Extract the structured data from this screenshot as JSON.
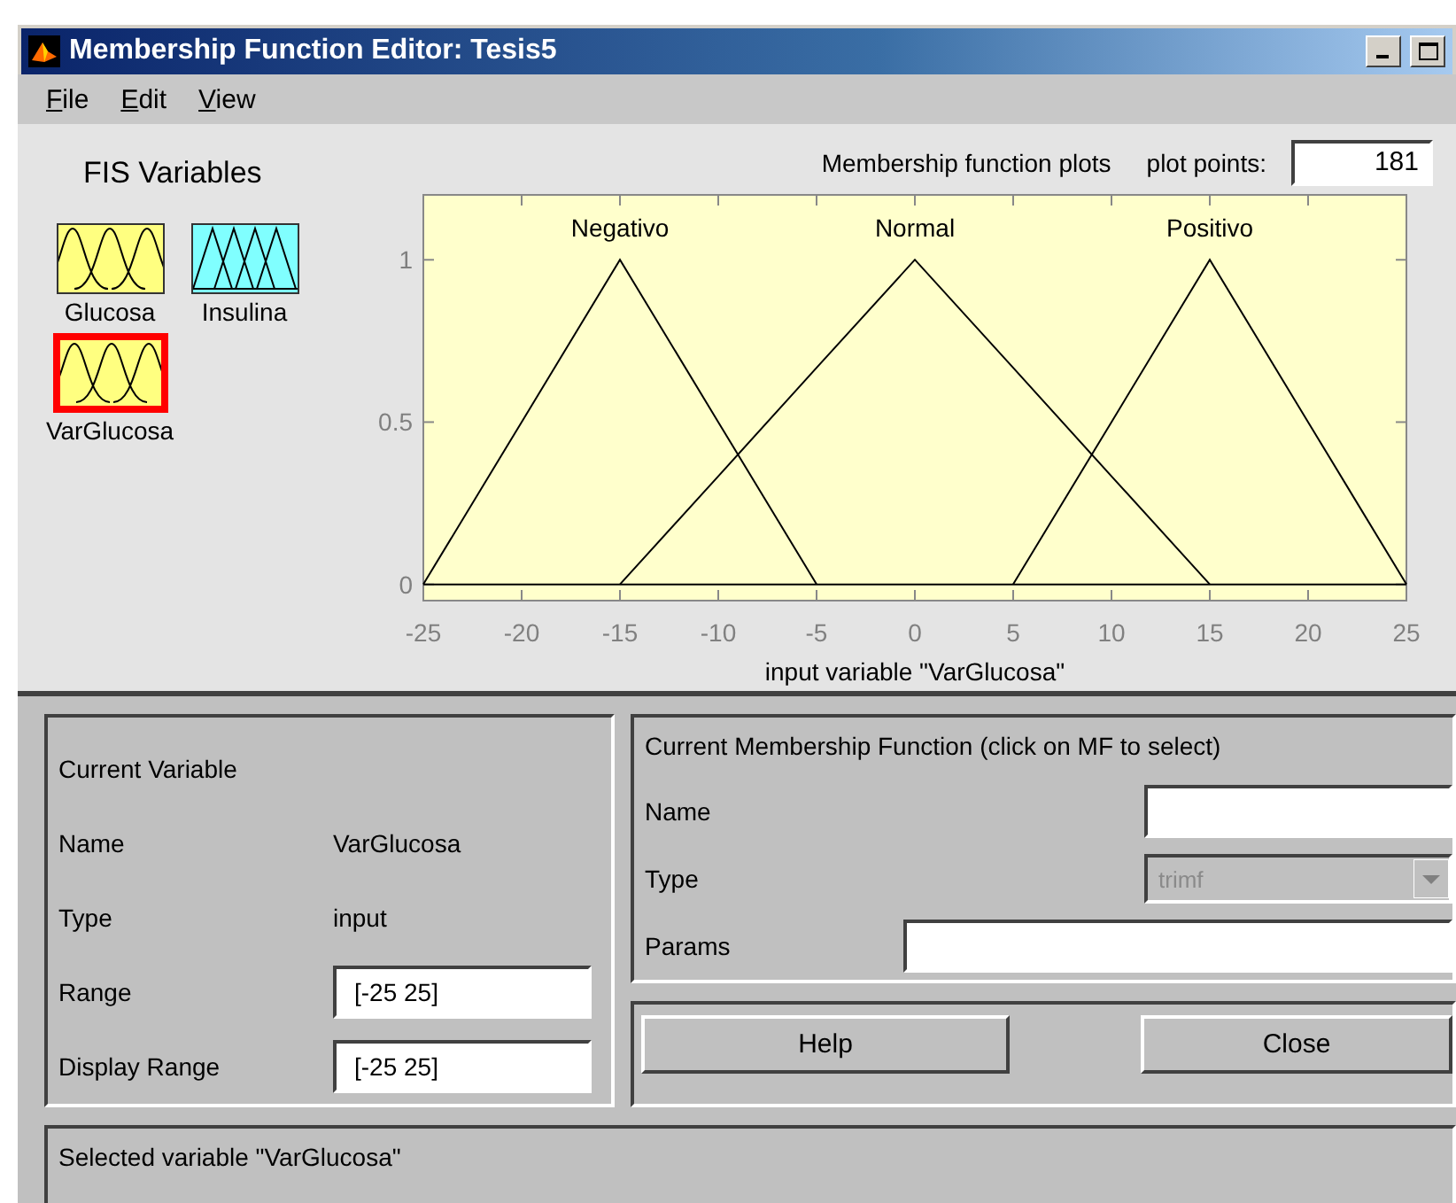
{
  "window": {
    "title": "Membership Function Editor: Tesis5"
  },
  "menu": [
    {
      "label": "File"
    },
    {
      "label": "Edit"
    },
    {
      "label": "View"
    }
  ],
  "fis_variables": {
    "title": "FIS Variables",
    "items": [
      {
        "name": "Glucosa",
        "kind": "input",
        "selected": false
      },
      {
        "name": "Insulina",
        "kind": "output",
        "selected": false
      },
      {
        "name": "VarGlucosa",
        "kind": "input",
        "selected": true
      }
    ]
  },
  "plot": {
    "plot_points": {
      "label": "plot points:",
      "value": "181"
    },
    "chart_data": {
      "type": "line",
      "title": "Membership function plots",
      "xlabel": "input variable \"VarGlucosa\"",
      "x": [
        -25,
        -20,
        -15,
        -10,
        -5,
        0,
        5,
        10,
        15,
        20,
        25
      ],
      "series": [
        {
          "name": "Negativo",
          "color": "#000000",
          "values": [
            0,
            0.5,
            1,
            0.5,
            0,
            null,
            null,
            null,
            null,
            null,
            null
          ]
        },
        {
          "name": "Normal",
          "color": "#000000",
          "values": [
            null,
            null,
            0,
            0.333,
            0.667,
            1,
            0.667,
            0.333,
            0,
            null,
            null
          ]
        },
        {
          "name": "Positivo",
          "color": "#000000",
          "values": [
            null,
            null,
            null,
            null,
            null,
            null,
            0,
            0.5,
            1,
            0.5,
            0
          ]
        }
      ],
      "xlim": [
        -25,
        25
      ],
      "ylim": [
        -0.05,
        1.2
      ],
      "xticks": [
        -25,
        -20,
        -15,
        -10,
        -5,
        0,
        5,
        10,
        15,
        20,
        25
      ],
      "yticks": [
        0,
        0.5,
        1
      ]
    }
  },
  "current_variable": {
    "title": "Current Variable",
    "name": {
      "label": "Name",
      "value": "VarGlucosa"
    },
    "type": {
      "label": "Type",
      "value": "input"
    },
    "range": {
      "label": "Range",
      "value": "[-25 25]"
    },
    "display_range": {
      "label": "Display Range",
      "value": "[-25 25]"
    }
  },
  "current_mf": {
    "title": "Current Membership Function (click on MF to select)",
    "name": {
      "label": "Name"
    },
    "type": {
      "label": "Type",
      "value": "trimf",
      "disabled": true
    },
    "params": {
      "label": "Params"
    }
  },
  "buttons": [
    "Help",
    "Close"
  ],
  "status": "Selected variable \"VarGlucosa\""
}
